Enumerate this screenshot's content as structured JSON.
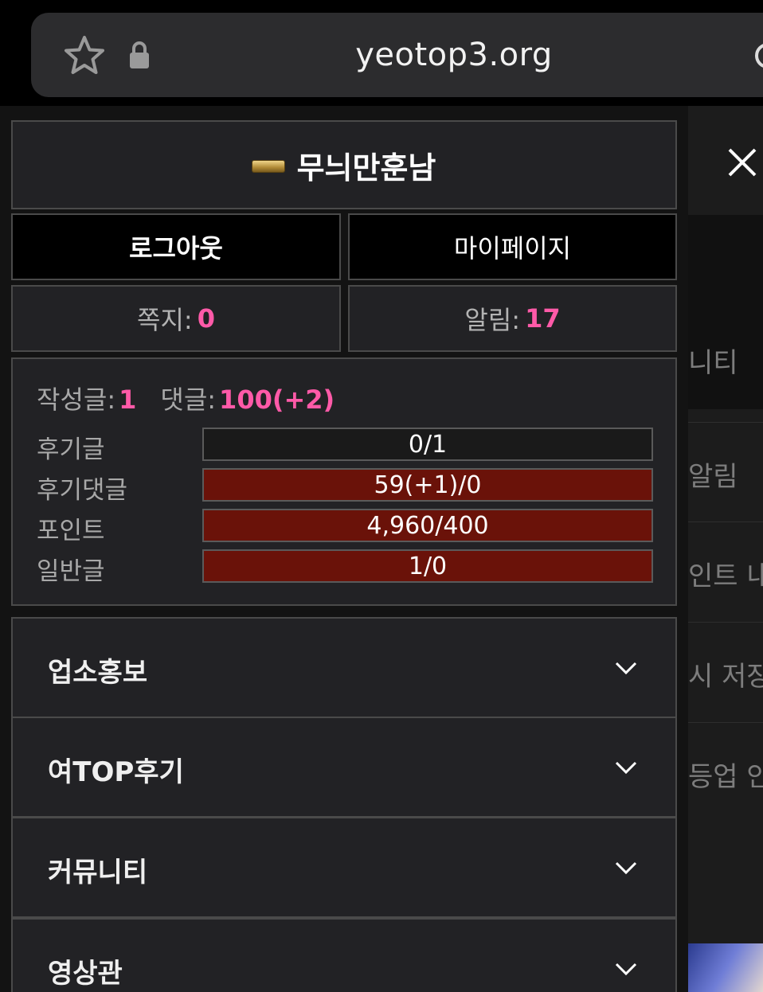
{
  "browser": {
    "url": "yeotop3.org"
  },
  "profile": {
    "nickname": "무늬만훈남"
  },
  "buttons": {
    "logout": "로그아웃",
    "mypage": "마이페이지"
  },
  "stats": {
    "messages_label": "쪽지:",
    "messages_value": "0",
    "alarms_label": "알림:",
    "alarms_value": "17"
  },
  "activity": {
    "posts_label": "작성글:",
    "posts_value": "1",
    "comments_label": "댓글:",
    "comments_value": "100(+2)",
    "rows": [
      {
        "label": "후기글",
        "value": "0/1",
        "fill": 0
      },
      {
        "label": "후기댓글",
        "value": "59(+1)/0",
        "fill": 1
      },
      {
        "label": "포인트",
        "value": "4,960/400",
        "fill": 1
      },
      {
        "label": "일반글",
        "value": "1/0",
        "fill": 1
      }
    ]
  },
  "menu": [
    {
      "label": "업소홍보"
    },
    {
      "label": "여TOP후기"
    },
    {
      "label": "커뮤니티"
    },
    {
      "label": "영상관"
    }
  ],
  "background_menu": [
    "니티",
    "알림",
    "인트 내역",
    "시 저장함",
    "등업 안내"
  ],
  "colors": {
    "accent_pink": "#ff5aa8",
    "bar_fill": "#6a1209"
  }
}
